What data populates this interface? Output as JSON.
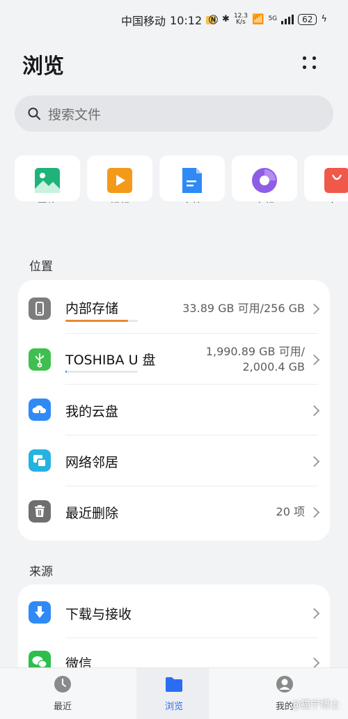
{
  "status_bar": {
    "carrier": "中国移动",
    "time": "10:12",
    "speed_top": "12.3",
    "speed_bottom": "K/s",
    "network": "5G",
    "battery": "62"
  },
  "header": {
    "title": "浏览"
  },
  "search": {
    "placeholder": "搜索文件"
  },
  "categories": [
    {
      "label": "图片",
      "icon": "image-icon",
      "color": "#1fb37a"
    },
    {
      "label": "视频",
      "icon": "video-icon",
      "color": "#f39a1b"
    },
    {
      "label": "文档",
      "icon": "document-icon",
      "color": "#2f8af5"
    },
    {
      "label": "音频",
      "icon": "audio-icon",
      "color": "#8f5ce8"
    },
    {
      "label": "应用",
      "icon": "app-icon",
      "color": "#f0584a"
    }
  ],
  "locations": {
    "title": "位置",
    "items": [
      {
        "name": "内部存储",
        "meta": "33.89 GB 可用/256 GB",
        "used_fraction": 0.87,
        "bar_color": "#e8892c"
      },
      {
        "name": "TOSHIBA U 盘",
        "meta_line1": "1,990.89 GB 可用/",
        "meta_line2": "2,000.4 GB",
        "used_fraction": 0.005,
        "bar_color": "#2f8af5"
      },
      {
        "name": "我的云盘"
      },
      {
        "name": "网络邻居"
      },
      {
        "name": "最近删除",
        "meta": "20 项"
      }
    ]
  },
  "sources": {
    "title": "来源",
    "items": [
      {
        "name": "下载与接收"
      },
      {
        "name": "微信"
      }
    ]
  },
  "bottom_nav": {
    "recent": "最近",
    "browse": "浏览",
    "mine": "我的",
    "active_color": "#2a6df4"
  },
  "watermark": "@猫宁博士"
}
